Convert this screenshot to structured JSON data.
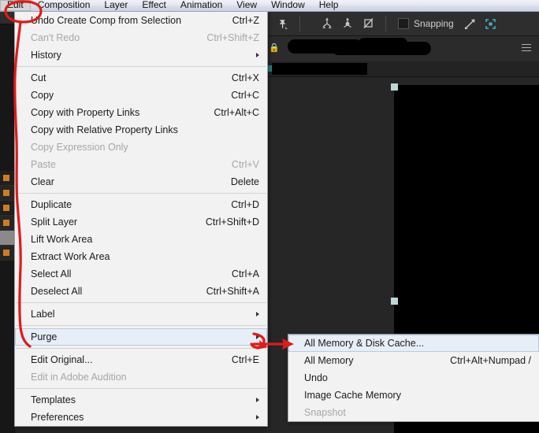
{
  "menubar": {
    "items": [
      {
        "label": "Edit",
        "active": true
      },
      {
        "label": "Composition",
        "active": false
      },
      {
        "label": "Layer",
        "active": false
      },
      {
        "label": "Effect",
        "active": false
      },
      {
        "label": "Animation",
        "active": false
      },
      {
        "label": "View",
        "active": false
      },
      {
        "label": "Window",
        "active": false
      },
      {
        "label": "Help",
        "active": false
      }
    ]
  },
  "toolbar": {
    "pin_icon": "pushpin-icon",
    "axis_world_icon": "world-axis-icon",
    "axis_local_icon": "local-axis-icon",
    "axis_view_icon": "view-axis-icon",
    "snapping_label": "Snapping",
    "snapping_checked": false,
    "snap_arrow_icon": "snap-arrow-icon",
    "roi_icon": "region-of-interest-icon"
  },
  "panel": {
    "lock_icon": "lock-icon",
    "menu_icon": "panel-menu-icon",
    "redacted_tab_1": "",
    "redacted_tab_2": "",
    "redacted_subtab": ""
  },
  "viewer": {
    "handle_icon": "selection-handle"
  },
  "edit_menu": {
    "title": "Edit",
    "rows": [
      {
        "type": "item",
        "label": "Undo Create Comp from Selection",
        "accel": "Ctrl+Z",
        "disabled": false,
        "submenu": false,
        "highlighted": false
      },
      {
        "type": "item",
        "label": "Can't Redo",
        "accel": "Ctrl+Shift+Z",
        "disabled": true,
        "submenu": false,
        "highlighted": false
      },
      {
        "type": "item",
        "label": "History",
        "accel": "",
        "disabled": false,
        "submenu": true,
        "highlighted": false
      },
      {
        "type": "sep"
      },
      {
        "type": "item",
        "label": "Cut",
        "accel": "Ctrl+X",
        "disabled": false,
        "submenu": false,
        "highlighted": false
      },
      {
        "type": "item",
        "label": "Copy",
        "accel": "Ctrl+C",
        "disabled": false,
        "submenu": false,
        "highlighted": false
      },
      {
        "type": "item",
        "label": "Copy with Property Links",
        "accel": "Ctrl+Alt+C",
        "disabled": false,
        "submenu": false,
        "highlighted": false
      },
      {
        "type": "item",
        "label": "Copy with Relative Property Links",
        "accel": "",
        "disabled": false,
        "submenu": false,
        "highlighted": false
      },
      {
        "type": "item",
        "label": "Copy Expression Only",
        "accel": "",
        "disabled": true,
        "submenu": false,
        "highlighted": false
      },
      {
        "type": "item",
        "label": "Paste",
        "accel": "Ctrl+V",
        "disabled": true,
        "submenu": false,
        "highlighted": false
      },
      {
        "type": "item",
        "label": "Clear",
        "accel": "Delete",
        "disabled": false,
        "submenu": false,
        "highlighted": false
      },
      {
        "type": "sep"
      },
      {
        "type": "item",
        "label": "Duplicate",
        "accel": "Ctrl+D",
        "disabled": false,
        "submenu": false,
        "highlighted": false
      },
      {
        "type": "item",
        "label": "Split Layer",
        "accel": "Ctrl+Shift+D",
        "disabled": false,
        "submenu": false,
        "highlighted": false
      },
      {
        "type": "item",
        "label": "Lift Work Area",
        "accel": "",
        "disabled": false,
        "submenu": false,
        "highlighted": false
      },
      {
        "type": "item",
        "label": "Extract Work Area",
        "accel": "",
        "disabled": false,
        "submenu": false,
        "highlighted": false
      },
      {
        "type": "item",
        "label": "Select All",
        "accel": "Ctrl+A",
        "disabled": false,
        "submenu": false,
        "highlighted": false
      },
      {
        "type": "item",
        "label": "Deselect All",
        "accel": "Ctrl+Shift+A",
        "disabled": false,
        "submenu": false,
        "highlighted": false
      },
      {
        "type": "sep"
      },
      {
        "type": "item",
        "label": "Label",
        "accel": "",
        "disabled": false,
        "submenu": true,
        "highlighted": false
      },
      {
        "type": "sep"
      },
      {
        "type": "item",
        "label": "Purge",
        "accel": "",
        "disabled": false,
        "submenu": true,
        "highlighted": true
      },
      {
        "type": "sep"
      },
      {
        "type": "item",
        "label": "Edit Original...",
        "accel": "Ctrl+E",
        "disabled": false,
        "submenu": false,
        "highlighted": false
      },
      {
        "type": "item",
        "label": "Edit in Adobe Audition",
        "accel": "",
        "disabled": true,
        "submenu": false,
        "highlighted": false
      },
      {
        "type": "sep"
      },
      {
        "type": "item",
        "label": "Templates",
        "accel": "",
        "disabled": false,
        "submenu": true,
        "highlighted": false
      },
      {
        "type": "item",
        "label": "Preferences",
        "accel": "",
        "disabled": false,
        "submenu": true,
        "highlighted": false
      }
    ]
  },
  "purge_menu": {
    "title": "Purge",
    "rows": [
      {
        "type": "item",
        "label": "All Memory & Disk Cache...",
        "accel": "",
        "disabled": false,
        "submenu": false,
        "highlighted": true
      },
      {
        "type": "item",
        "label": "All Memory",
        "accel": "Ctrl+Alt+Numpad /",
        "disabled": false,
        "submenu": false,
        "highlighted": false
      },
      {
        "type": "item",
        "label": "Undo",
        "accel": "",
        "disabled": false,
        "submenu": false,
        "highlighted": false
      },
      {
        "type": "item",
        "label": "Image Cache Memory",
        "accel": "",
        "disabled": false,
        "submenu": false,
        "highlighted": false
      },
      {
        "type": "item",
        "label": "Snapshot",
        "accel": "",
        "disabled": true,
        "submenu": false,
        "highlighted": false
      }
    ]
  },
  "annotations": {
    "color": "#e01b18",
    "circle_target": "Edit",
    "arrow_target": "All Memory & Disk Cache..."
  }
}
